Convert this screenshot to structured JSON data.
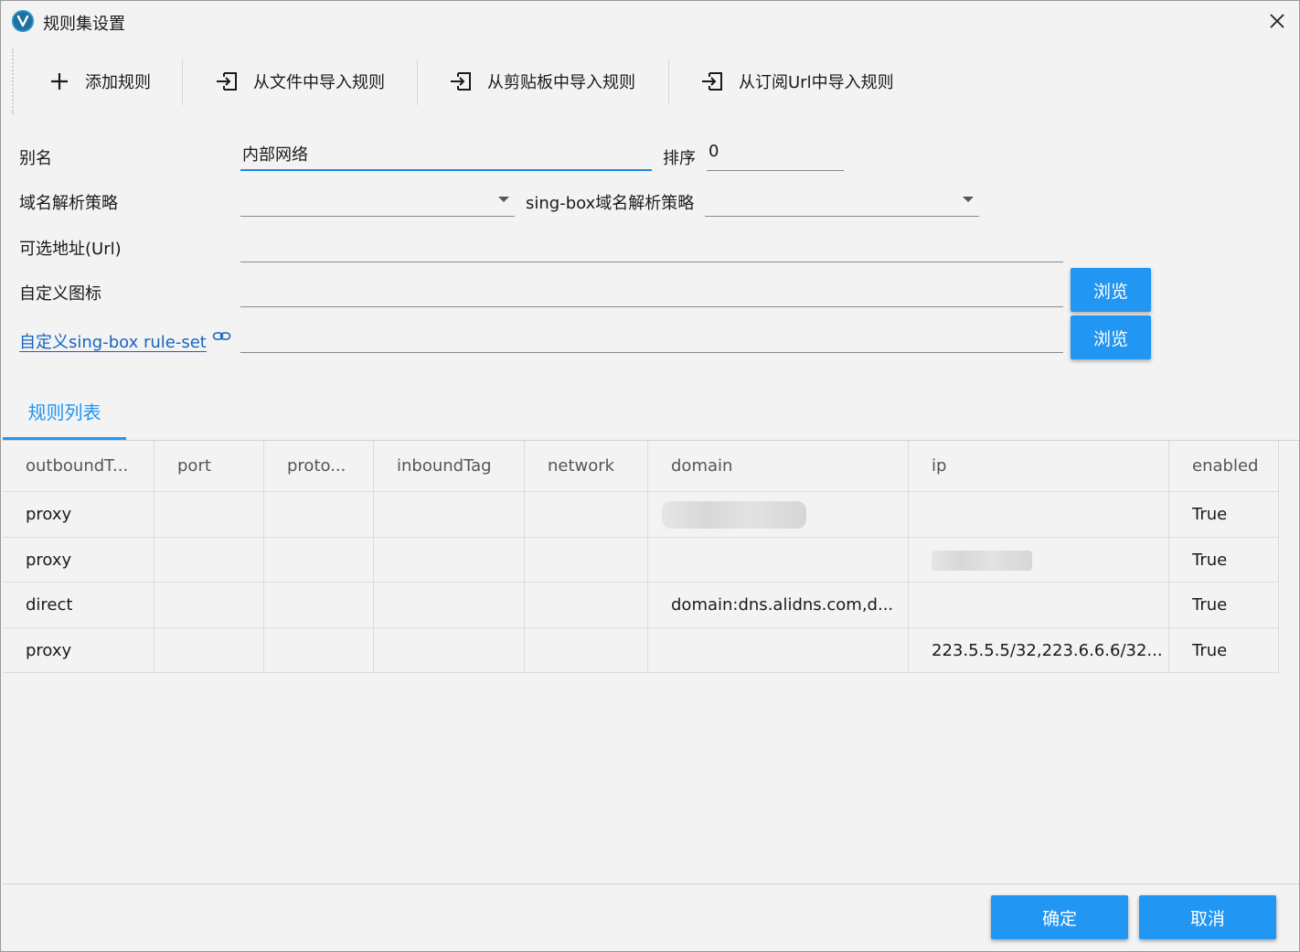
{
  "window": {
    "title": "规则集设置"
  },
  "toolbar": {
    "add_rule": "添加规则",
    "import_file": "从文件中导入规则",
    "import_clipboard": "从剪贴板中导入规则",
    "import_url": "从订阅Url中导入规则"
  },
  "form": {
    "alias_label": "别名",
    "alias_value": "内部网络",
    "sort_label": "排序",
    "sort_value": "0",
    "domain_strategy_label": "域名解析策略",
    "domain_strategy_value": "",
    "singbox_strategy_label": "sing-box域名解析策略",
    "singbox_strategy_value": "",
    "url_label": "可选地址(Url)",
    "url_value": "",
    "icon_label": "自定义图标",
    "icon_value": "",
    "ruleset_label": "自定义sing-box rule-set",
    "ruleset_value": "",
    "browse_label": "浏览"
  },
  "tabs": {
    "rule_list": "规则列表"
  },
  "table": {
    "headers": [
      "outboundT...",
      "port",
      "proto...",
      "inboundTag",
      "network",
      "domain",
      "ip",
      "enabled"
    ],
    "rows": [
      [
        "proxy",
        "",
        "",
        "",
        "",
        "",
        "",
        "True"
      ],
      [
        "proxy",
        "",
        "",
        "",
        "",
        "",
        "",
        "True"
      ],
      [
        "direct",
        "",
        "",
        "",
        "",
        "domain:dns.alidns.com,d...",
        "",
        "True"
      ],
      [
        "proxy",
        "",
        "",
        "",
        "",
        "",
        "223.5.5.5/32,223.6.6.6/32...",
        "True"
      ]
    ]
  },
  "footer": {
    "ok": "确定",
    "cancel": "取消"
  },
  "colors": {
    "accent": "#2196f3",
    "link": "#1565c0"
  }
}
